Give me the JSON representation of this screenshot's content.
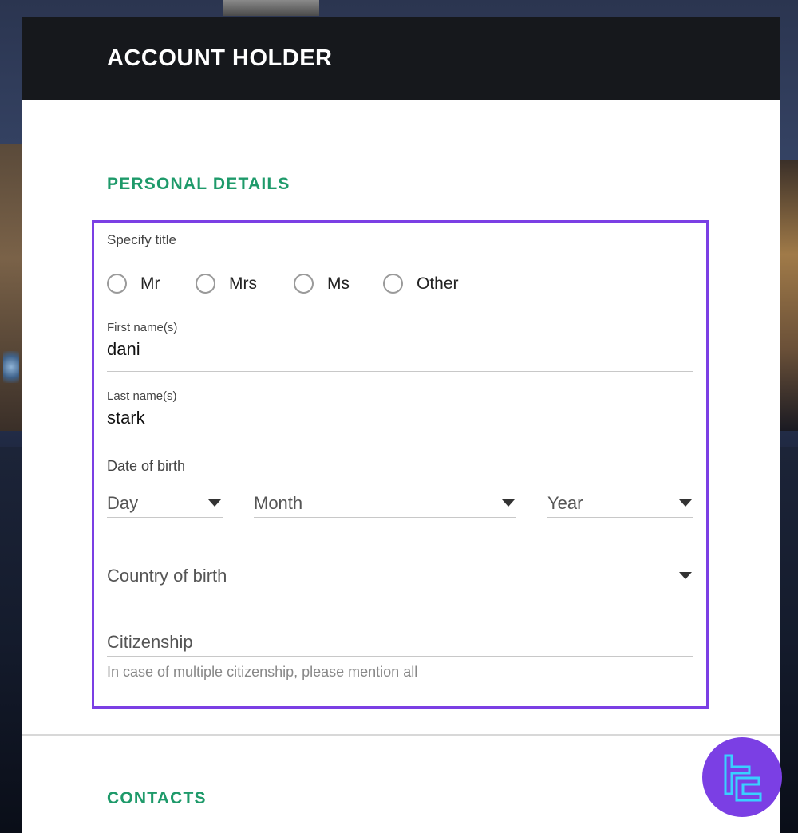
{
  "header": {
    "title": "ACCOUNT HOLDER"
  },
  "sections": {
    "personal": "PERSONAL DETAILS",
    "contacts": "CONTACTS"
  },
  "title_group": {
    "label": "Specify title",
    "options": [
      "Mr",
      "Mrs",
      "Ms",
      "Other"
    ]
  },
  "first_name": {
    "label": "First name(s)",
    "value": "dani"
  },
  "last_name": {
    "label": "Last name(s)",
    "value": "stark"
  },
  "dob": {
    "label": "Date of birth",
    "day_placeholder": "Day",
    "month_placeholder": "Month",
    "year_placeholder": "Year"
  },
  "country_of_birth": {
    "placeholder": "Country of birth"
  },
  "citizenship": {
    "placeholder": "Citizenship",
    "helper": "In case of multiple citizenship, please mention all"
  },
  "colors": {
    "accent_green": "#1e9a6a",
    "highlight_purple": "#7b3fe4",
    "header_bg": "#16181c"
  }
}
